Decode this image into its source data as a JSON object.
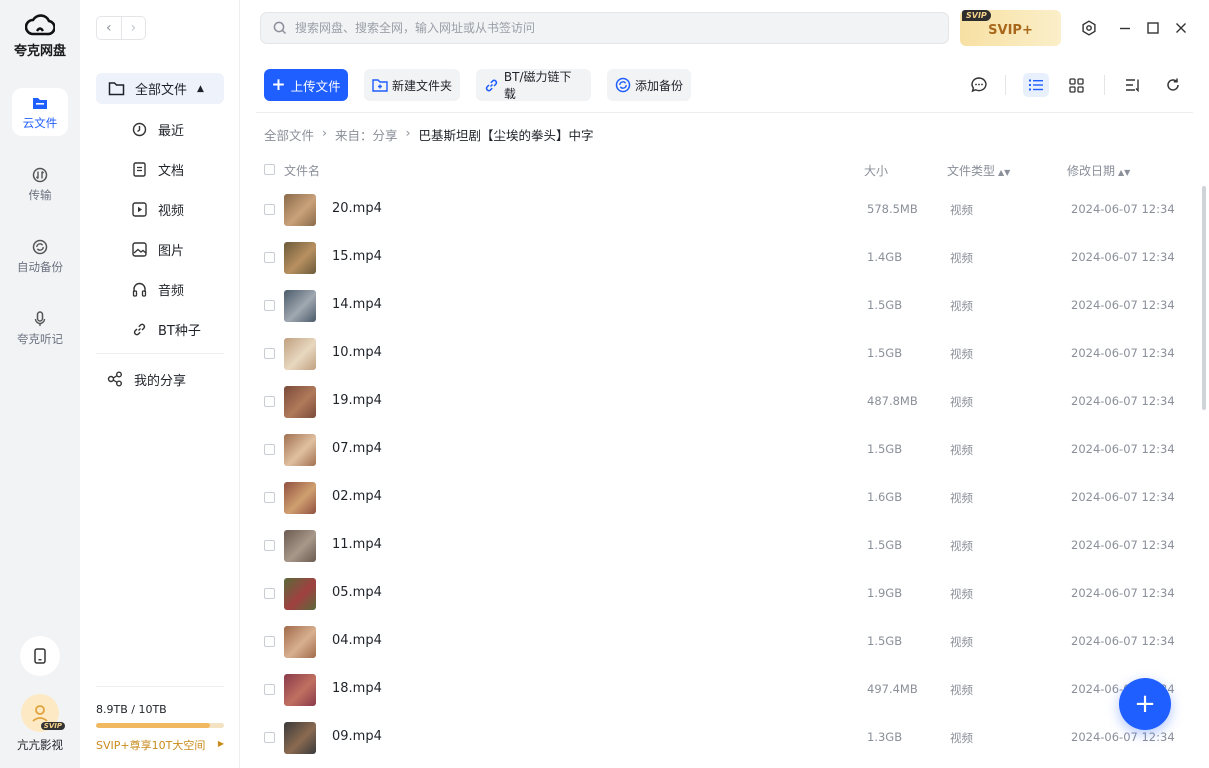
{
  "app": {
    "name": "夸克网盘",
    "search_placeholder": "搜索网盘、搜索全网，输入网址或从书签访问",
    "svip_badge": "SVIP",
    "svip_label": "SVIP+"
  },
  "rail": {
    "items": [
      {
        "label": "云文件",
        "icon": "folder-icon"
      },
      {
        "label": "传输",
        "icon": "transfer-icon"
      },
      {
        "label": "自动备份",
        "icon": "backup-icon"
      },
      {
        "label": "夸克听记",
        "icon": "microphone-icon"
      }
    ],
    "user_name": "亢亢影视",
    "user_badge": "SVIP"
  },
  "sidebar": {
    "all_files": "全部文件",
    "items": [
      {
        "label": "最近",
        "icon": "clock-icon"
      },
      {
        "label": "文档",
        "icon": "document-icon"
      },
      {
        "label": "视频",
        "icon": "video-icon"
      },
      {
        "label": "图片",
        "icon": "image-icon"
      },
      {
        "label": "音频",
        "icon": "headphones-icon"
      },
      {
        "label": "BT种子",
        "icon": "link-icon"
      }
    ],
    "my_share": "我的分享",
    "storage_used": "8.9TB",
    "storage_total": "10TB",
    "storage_fraction": 0.89,
    "promo": "SVIP+尊享10T大空间"
  },
  "toolbar": {
    "upload": "上传文件",
    "new_folder": "新建文件夹",
    "bt_download": "BT/磁力链下载",
    "add_backup": "添加备份"
  },
  "breadcrumb": {
    "root": "全部文件",
    "from": "来自：分享",
    "current": "巴基斯坦剧【尘埃的拳头】中字"
  },
  "table": {
    "headers": {
      "name": "文件名",
      "size": "大小",
      "type": "文件类型",
      "date": "修改日期"
    },
    "rows": [
      {
        "name": "20.mp4",
        "size": "578.5MB",
        "type": "视频",
        "date": "2024-06-07 12:34"
      },
      {
        "name": "15.mp4",
        "size": "1.4GB",
        "type": "视频",
        "date": "2024-06-07 12:34"
      },
      {
        "name": "14.mp4",
        "size": "1.5GB",
        "type": "视频",
        "date": "2024-06-07 12:34"
      },
      {
        "name": "10.mp4",
        "size": "1.5GB",
        "type": "视频",
        "date": "2024-06-07 12:34"
      },
      {
        "name": "19.mp4",
        "size": "487.8MB",
        "type": "视频",
        "date": "2024-06-07 12:34"
      },
      {
        "name": "07.mp4",
        "size": "1.5GB",
        "type": "视频",
        "date": "2024-06-07 12:34"
      },
      {
        "name": "02.mp4",
        "size": "1.6GB",
        "type": "视频",
        "date": "2024-06-07 12:34"
      },
      {
        "name": "11.mp4",
        "size": "1.5GB",
        "type": "视频",
        "date": "2024-06-07 12:34"
      },
      {
        "name": "05.mp4",
        "size": "1.9GB",
        "type": "视频",
        "date": "2024-06-07 12:34"
      },
      {
        "name": "04.mp4",
        "size": "1.5GB",
        "type": "视频",
        "date": "2024-06-07 12:34"
      },
      {
        "name": "18.mp4",
        "size": "497.4MB",
        "type": "视频",
        "date": "2024-06-07 12:34"
      },
      {
        "name": "09.mp4",
        "size": "1.3GB",
        "type": "视频",
        "date": "2024-06-07 12:34"
      }
    ]
  },
  "colors": {
    "accent": "#1f5eff",
    "svip_gold": "#f0b961"
  }
}
